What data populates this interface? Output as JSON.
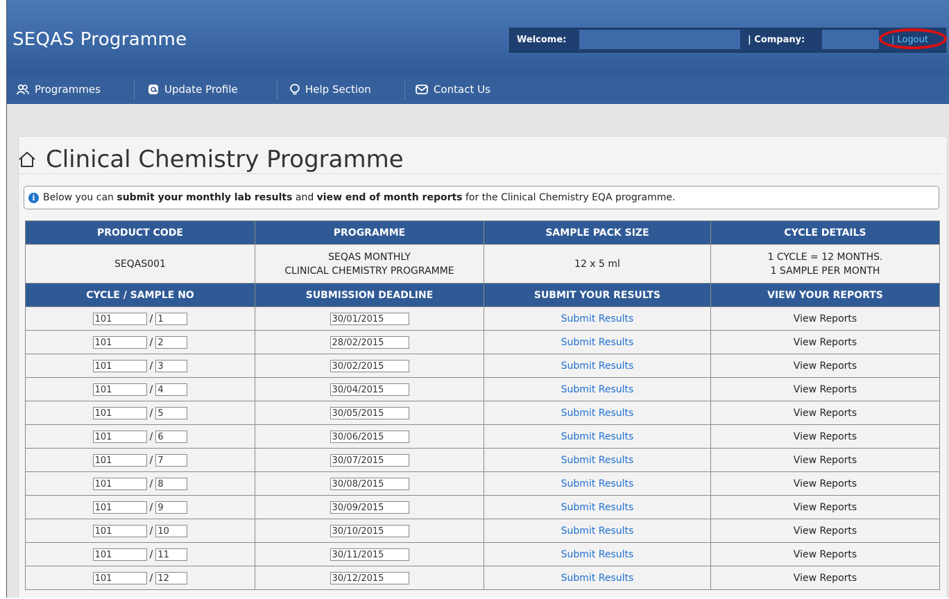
{
  "header": {
    "app_title": "SEQAS Programme",
    "welcome_label": "Welcome:",
    "welcome_value": "",
    "company_label": "| Company:",
    "company_value": "",
    "logout_label": "| Logout"
  },
  "nav": {
    "items": [
      {
        "label": "Programmes",
        "icon": "users-icon"
      },
      {
        "label": "Update Profile",
        "icon": "at-sign-icon"
      },
      {
        "label": "Help Section",
        "icon": "lightbulb-icon"
      },
      {
        "label": "Contact Us",
        "icon": "envelope-icon"
      }
    ]
  },
  "page": {
    "title": "Clinical Chemistry Programme",
    "info": {
      "t1": "Below you can ",
      "b1": "submit your monthly lab results",
      "t2": " and ",
      "b2": "view end of month reports",
      "t3": " for the Clinical Chemistry EQA programme."
    }
  },
  "table": {
    "headers": [
      "PRODUCT CODE",
      "PROGRAMME",
      "SAMPLE PACK SIZE",
      "CYCLE DETAILS"
    ],
    "product": {
      "code": "SEQAS001",
      "programme_line1": "SEQAS MONTHLY",
      "programme_line2": "CLINICAL CHEMISTRY PROGRAMME",
      "pack_size": "12 x 5 ml",
      "cycle_line1": "1 CYCLE = 12 MONTHS.",
      "cycle_line2": "1 SAMPLE PER MONTH"
    },
    "headers2": [
      "CYCLE / SAMPLE NO",
      "SUBMISSION DEADLINE",
      "SUBMIT YOUR RESULTS",
      "VIEW YOUR REPORTS"
    ],
    "submit_label": "Submit Results",
    "view_label": "View Reports",
    "rows": [
      {
        "cycle": "101",
        "sample": "1",
        "deadline": "30/01/2015"
      },
      {
        "cycle": "101",
        "sample": "2",
        "deadline": "28/02/2015"
      },
      {
        "cycle": "101",
        "sample": "3",
        "deadline": "30/02/2015"
      },
      {
        "cycle": "101",
        "sample": "4",
        "deadline": "30/04/2015"
      },
      {
        "cycle": "101",
        "sample": "5",
        "deadline": "30/05/2015"
      },
      {
        "cycle": "101",
        "sample": "6",
        "deadline": "30/06/2015"
      },
      {
        "cycle": "101",
        "sample": "7",
        "deadline": "30/07/2015"
      },
      {
        "cycle": "101",
        "sample": "8",
        "deadline": "30/08/2015"
      },
      {
        "cycle": "101",
        "sample": "9",
        "deadline": "30/09/2015"
      },
      {
        "cycle": "101",
        "sample": "10",
        "deadline": "30/10/2015"
      },
      {
        "cycle": "101",
        "sample": "11",
        "deadline": "30/11/2015"
      },
      {
        "cycle": "101",
        "sample": "12",
        "deadline": "30/12/2015"
      }
    ]
  },
  "colors": {
    "header_blue": "#3a67a8",
    "nav_blue": "#36609b",
    "table_header": "#2f5a96",
    "link_blue": "#1f6fd0",
    "logout_blue": "#5bc2ff",
    "highlight_red": "#e01010"
  }
}
